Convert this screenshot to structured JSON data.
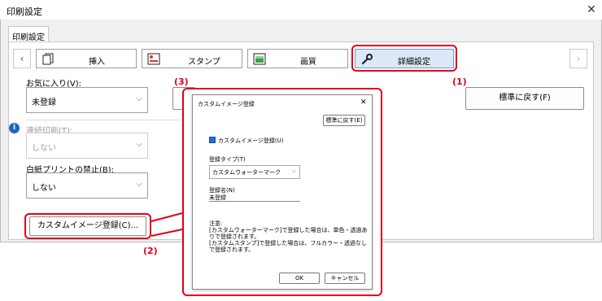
{
  "window": {
    "title": "印刷設定",
    "tab": "印刷設定"
  },
  "toolbar": {
    "tabs": [
      {
        "label": "挿入",
        "icon": "insert-icon"
      },
      {
        "label": "スタンプ",
        "icon": "stamp-icon"
      },
      {
        "label": "画質",
        "icon": "image-quality-icon"
      },
      {
        "label": "詳細設定",
        "icon": "wrench-icon"
      }
    ]
  },
  "form": {
    "favorites_label": "お気に入り(V):",
    "favorites_value": "未登録",
    "reset_button": "標準に戻す(F)",
    "continuous_label": "連続印刷(T):",
    "continuous_value": "しない",
    "blank_label": "白紙プリントの禁止(B):",
    "blank_value": "しない",
    "custom_image_button": "カスタムイメージ登録(C)..."
  },
  "callouts": [
    "(1)",
    "(2)",
    "(3)"
  ],
  "dialog": {
    "title": "カスタムイメージ登録",
    "reset_button": "標準に戻す(E)",
    "checkbox_label": "カスタムイメージ登録(U)",
    "type_label": "登録タイプ(T)",
    "type_value": "カスタムウォーターマーク",
    "name_label": "登録名(N)",
    "name_value": "未登録",
    "note": "注意:\n[カスタムウォーターマーク]で登録した場合は、単色・透過ありで登録されます。\n[カスタムスタンプ]で登録した場合は、フルカラー・透過なしで登録されます。",
    "ok_button": "OK",
    "cancel_button": "キャンセル"
  },
  "colors": {
    "highlight": "#e2001a",
    "selected_tab": "#dbe8f7"
  }
}
